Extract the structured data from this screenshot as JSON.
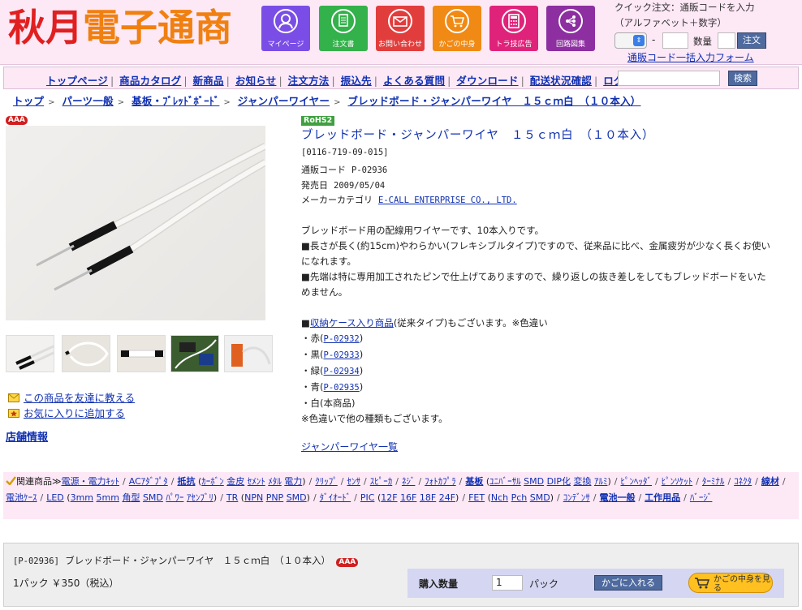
{
  "header": {
    "logo_text_1": "秋月",
    "logo_text_2": "電子通商",
    "nav": [
      {
        "label": "マイページ",
        "icon": "person-icon",
        "color": "#7a4ee6"
      },
      {
        "label": "注文書",
        "icon": "order-form-icon",
        "color": "#33b14a"
      },
      {
        "label": "お問い合わせ",
        "icon": "mail-icon",
        "color": "#e23d3d"
      },
      {
        "label": "かごの中身",
        "icon": "cart-icon",
        "color": "#f08a14"
      },
      {
        "label": "トラ技広告",
        "icon": "calculator-icon",
        "color": "#e0237a"
      },
      {
        "label": "回路図集",
        "icon": "circuit-icon",
        "color": "#8d2fa0"
      }
    ],
    "quick_order": {
      "line1": "クイック注文：通販コードを入力",
      "line2": "（アルファベット＋数字）",
      "dash": "-",
      "qty_label": "数量",
      "button": "注文",
      "bulk_link": "通販コード一括入力フォーム"
    }
  },
  "menu": {
    "items": [
      "トップページ",
      "商品カタログ",
      "新商品",
      "お知らせ",
      "注文方法",
      "振込先",
      "よくある質問",
      "ダウンロード",
      "配送状況確認",
      "ログイン"
    ],
    "search_button": "検索"
  },
  "breadcrumb": [
    "トップ",
    "パーツ一般",
    "基板・ﾌﾞﾚｯﾄﾞﾎﾞｰﾄﾞ",
    "ジャンパーワイヤー",
    "ブレッドボード・ジャンパーワイヤ　１５ｃｍ白　（１０本入）"
  ],
  "breadcrumb_sep": ">",
  "product": {
    "badge": "AAA",
    "rohs": "RoHS2",
    "title": "ブレッドボード・ジャンパーワイヤ　１５ｃｍ白　（１０本入）",
    "code_bracket": "[0116-719-09-015]",
    "code_label": "通販コード",
    "code": "P-02936",
    "date_label": "発売日",
    "date": "2009/05/04",
    "maker_label": "メーカーカテゴリ",
    "maker": "E-CALL ENTERPRISE CO., LTD.",
    "desc": [
      "ブレッドボード用の配線用ワイヤーです、10本入りです。",
      "■長さが長く(約15cm)やわらかい(フレキシブルタイプ)ですので、従来品に比べ、金属疲労が少なく長くお使い",
      "になれます。",
      "■先端は特に専用加工されたピンで仕上げてありますので、繰り返しの抜き差しをしてもブレッドボードをいた",
      "めません。"
    ],
    "case_prefix": "■",
    "case_link": "収納ケース入り商品",
    "case_suffix": "(従来タイプ)もございます。※色違い",
    "colors": [
      {
        "name": "・赤(",
        "code": "P-02932"
      },
      {
        "name": "・黒(",
        "code": "P-02933"
      },
      {
        "name": "・緑(",
        "code": "P-02934"
      },
      {
        "name": "・青(",
        "code": "P-02935"
      }
    ],
    "close_paren": ")",
    "white": "・白(本商品)",
    "note": "※色違いで他の種類もございます。",
    "list_link": "ジャンパーワイヤ一覧"
  },
  "left": {
    "friend_link": "この商品を友達に教える",
    "fav_link": "お気に入りに追加する",
    "store_link": "店舗情報"
  },
  "related": {
    "header": "関連商品≫",
    "groups": [
      [
        "電源・電力ｷｯﾄ"
      ],
      [
        "ACｱﾀﾞﾌﾟﾀ"
      ],
      [
        "抵抗",
        "(",
        "ｶｰﾎﾞﾝ",
        "金皮",
        "ｾﾒﾝﾄ",
        "ﾒﾀﾙ",
        "電力",
        ")"
      ],
      [
        "ｸﾘｯﾌﾟ"
      ],
      [
        "ｾﾝｻ"
      ],
      [
        "ｽﾋﾟｰｶ"
      ],
      [
        "ﾈｼﾞ"
      ],
      [
        "ﾌｫﾄｶﾌﾟﾗ"
      ],
      [
        "基板",
        "(",
        "ﾕﾆﾊﾞｰｻﾙ",
        "SMD",
        "DIP化",
        "変換",
        "ｱﾙﾐ",
        ")"
      ],
      [
        "ﾋﾟﾝﾍｯﾀﾞ"
      ],
      [
        "ﾋﾟﾝｿｹｯﾄ"
      ],
      [
        "ﾀｰﾐﾅﾙ"
      ],
      [
        "ｺﾈｸﾀ"
      ],
      [
        "線材"
      ],
      [
        "電池ｹｰｽ"
      ],
      [
        "LED",
        "(",
        "3mm",
        "5mm",
        "角型",
        "SMD",
        "ﾊﾟﾜｰ",
        "ｱｾﾝﾌﾞﾘ",
        ")"
      ],
      [
        "TR",
        "(",
        "NPN",
        "PNP",
        "SMD",
        ")"
      ],
      [
        "ﾀﾞｲｵｰﾄﾞ"
      ],
      [
        "PIC",
        "(",
        "12F",
        "16F",
        "18F",
        "24F",
        ")"
      ],
      [
        "FET",
        "(",
        "Nch",
        "Pch",
        "SMD",
        ")"
      ],
      [
        "ｺﾝﾃﾞﾝｻ"
      ],
      [
        "電池一般"
      ],
      [
        "工作用品"
      ],
      [
        "ﾊﾞｰｼﾞ"
      ]
    ],
    "sep": "/"
  },
  "bottom": {
    "code": "[P-02936]",
    "title": "ブレッドボード・ジャンパーワイヤ　１５ｃｍ白　（１０本入）",
    "badge": "AAA",
    "price_line": "1パック ￥350（税込）",
    "qty_label": "購入数量",
    "qty_value": "1",
    "unit": "パック",
    "add_button": "かごに入れる",
    "view_button": "かごの中身を見る"
  }
}
